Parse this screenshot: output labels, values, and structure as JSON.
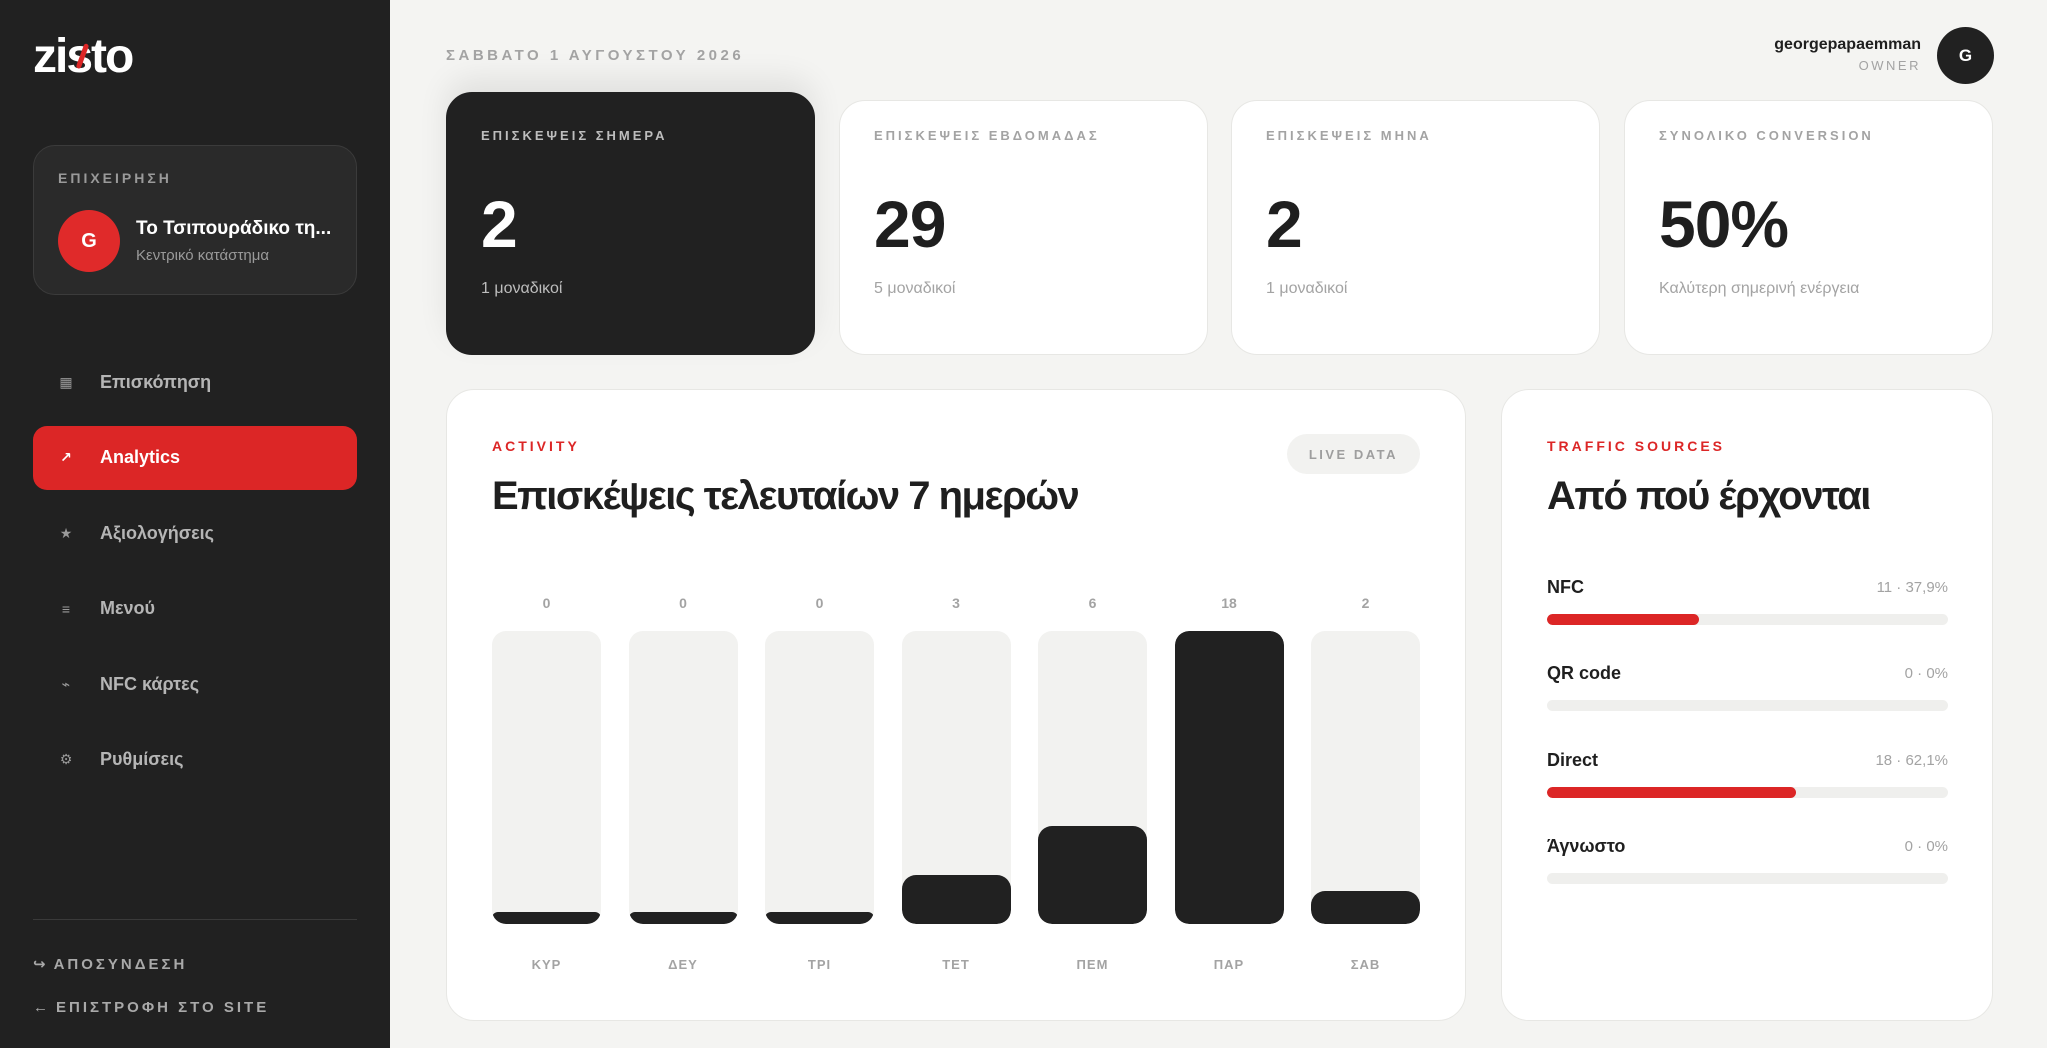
{
  "sidebar": {
    "logo_text": "zisto",
    "business": {
      "label": "ΕΠΙΧΕΙΡΗΣΗ",
      "avatar_initial": "G",
      "name": "Το Τσιπουράδικο τη...",
      "subtitle": "Κεντρικό κατάστημα"
    },
    "nav": [
      {
        "label": "Επισκόπηση",
        "icon": "grid-icon",
        "glyph": "▦",
        "active": false
      },
      {
        "label": "Analytics",
        "icon": "arrow-up-right-icon",
        "glyph": "↗",
        "active": true
      },
      {
        "label": "Αξιολογήσεις",
        "icon": "star-icon",
        "glyph": "★",
        "active": false
      },
      {
        "label": "Μενού",
        "icon": "menu-lines-icon",
        "glyph": "≡",
        "active": false
      },
      {
        "label": "NFC κάρτες",
        "icon": "nfc-icon",
        "glyph": "⌁",
        "active": false
      },
      {
        "label": "Ρυθμίσεις",
        "icon": "settings-icon",
        "glyph": "⚙",
        "active": false
      }
    ],
    "logout_label": "ΑΠΟΣΥΝΔΕΣΗ",
    "logout_icon": "↪",
    "back_label": "ΕΠΙΣΤΡΟΦΗ ΣΤΟ SITE",
    "back_icon": "←"
  },
  "header": {
    "date": "ΣΑΒΒΑΤΟ 1 ΑΥΓΟΥΣΤΟΥ 2026",
    "user_name": "georgepapaemman",
    "user_role": "OWNER",
    "user_initial": "G"
  },
  "stats": [
    {
      "label": "ΕΠΙΣΚΕΨΕΙΣ ΣΗΜΕΡΑ",
      "value": "2",
      "sub": "1 μοναδικοί",
      "dark": true
    },
    {
      "label": "ΕΠΙΣΚΕΨΕΙΣ ΕΒΔΟΜΑΔΑΣ",
      "value": "29",
      "sub": "5 μοναδικοί",
      "dark": false
    },
    {
      "label": "ΕΠΙΣΚΕΨΕΙΣ ΜΗΝΑ",
      "value": "2",
      "sub": "1 μοναδικοί",
      "dark": false
    },
    {
      "label": "ΣΥΝΟΛΙΚΟ CONVERSION",
      "value": "50%",
      "sub": "Καλύτερη σημερινή ενέργεια",
      "dark": false
    }
  ],
  "activity": {
    "kicker": "ACTIVITY",
    "title": "Επισκέψεις τελευταίων 7 ημερών",
    "badge": "LIVE DATA"
  },
  "chart_data": {
    "type": "bar",
    "categories": [
      "ΚΥΡ",
      "ΔΕΥ",
      "ΤΡΙ",
      "ΤΕΤ",
      "ΠΕΜ",
      "ΠΑΡ",
      "ΣΑΒ"
    ],
    "values": [
      0,
      0,
      0,
      3,
      6,
      18,
      2
    ],
    "title": "Επισκέψεις τελευταίων 7 ημερών",
    "xlabel": "",
    "ylabel": "",
    "ylim": [
      0,
      18
    ],
    "grid": false,
    "bar_color": "#212121",
    "track_color": "#f2f2f0"
  },
  "traffic": {
    "kicker": "TRAFFIC SOURCES",
    "title": "Από πού έρχονται",
    "sources": [
      {
        "name": "NFC",
        "value_text": "11 · 37,9%",
        "share": 0.379
      },
      {
        "name": "QR code",
        "value_text": "0 · 0%",
        "share": 0
      },
      {
        "name": "Direct",
        "value_text": "18 · 62,1%",
        "share": 0.621
      },
      {
        "name": "Άγνωστο",
        "value_text": "0 · 0%",
        "share": 0
      }
    ]
  },
  "colors": {
    "accent": "#dc2626",
    "dark": "#212121",
    "background": "#f4f4f2"
  }
}
